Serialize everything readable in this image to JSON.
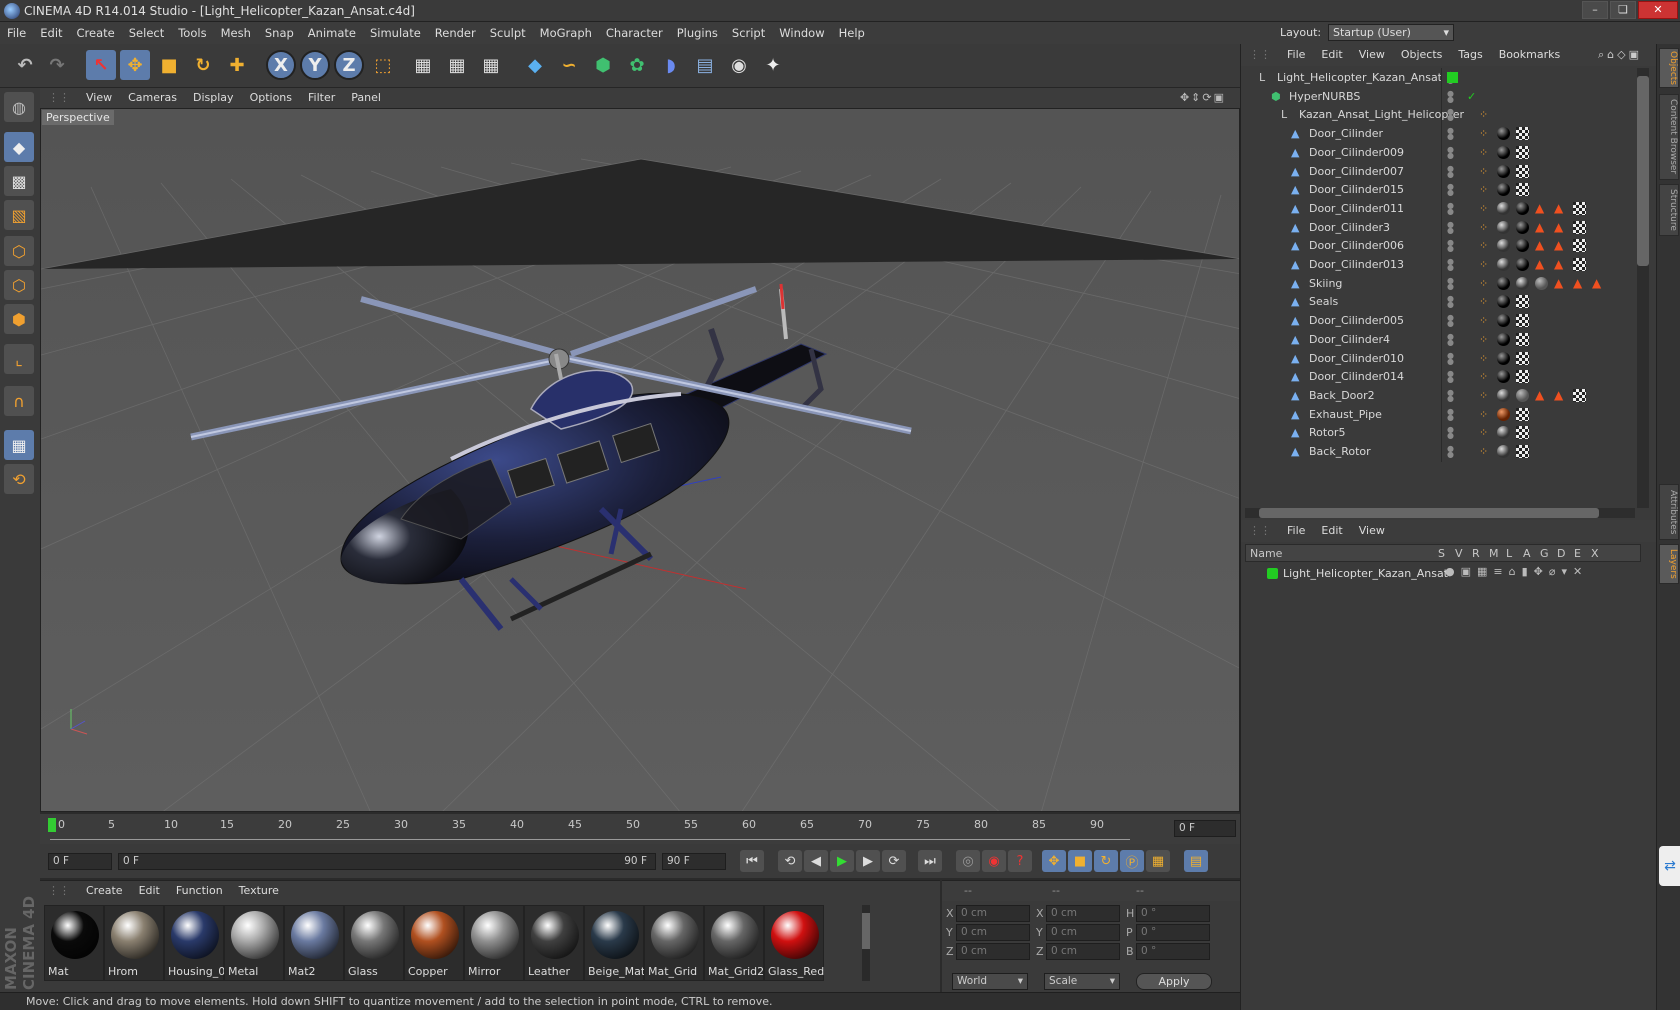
{
  "window": {
    "title": "CINEMA 4D R14.014 Studio - [Light_Helicopter_Kazan_Ansat.c4d]",
    "controls": [
      "–",
      "❏",
      "✕"
    ]
  },
  "menubar": [
    "File",
    "Edit",
    "Create",
    "Select",
    "Tools",
    "Mesh",
    "Snap",
    "Animate",
    "Simulate",
    "Render",
    "Sculpt",
    "MoGraph",
    "Character",
    "Plugins",
    "Script",
    "Window",
    "Help"
  ],
  "layout": {
    "label": "Layout:",
    "value": "Startup (User)"
  },
  "toolbar": {
    "x": "X",
    "y": "Y",
    "z": "Z"
  },
  "viewport": {
    "menu": [
      "View",
      "Cameras",
      "Display",
      "Options",
      "Filter",
      "Panel"
    ],
    "label": "Perspective"
  },
  "timeline": {
    "ticks": [
      "0",
      "5",
      "10",
      "15",
      "20",
      "25",
      "30",
      "35",
      "40",
      "45",
      "50",
      "55",
      "60",
      "65",
      "70",
      "75",
      "80",
      "85",
      "90"
    ],
    "frame_right": "0 F"
  },
  "transport": {
    "current": "0 F",
    "range_start": "0 F",
    "range_end": "90 F",
    "end": "90 F"
  },
  "materials": {
    "menu": [
      "Create",
      "Edit",
      "Function",
      "Texture"
    ],
    "items": [
      {
        "name": "Mat",
        "color": "#0a0a0a"
      },
      {
        "name": "Hrom",
        "color": "#8a8070"
      },
      {
        "name": "Housing_0",
        "color": "#2a3a6a"
      },
      {
        "name": "Metal",
        "color": "#a9a9a9"
      },
      {
        "name": "Mat2",
        "color": "#6a7aa0"
      },
      {
        "name": "Glass",
        "color": "#777777"
      },
      {
        "name": "Copper",
        "color": "#b05020"
      },
      {
        "name": "Mirror",
        "color": "#909090"
      },
      {
        "name": "Leather",
        "color": "#404040"
      },
      {
        "name": "Beige_Mat",
        "color": "#2a3a4a"
      },
      {
        "name": "Mat_Grid",
        "color": "#666666"
      },
      {
        "name": "Mat_Grid2",
        "color": "#666666"
      },
      {
        "name": "Glass_Red",
        "color": "#d01010"
      }
    ]
  },
  "coords": {
    "headers": [
      "--",
      "--",
      "--"
    ],
    "rows": [
      {
        "a": "X",
        "av": "0 cm",
        "b": "X",
        "bv": "0 cm",
        "c": "H",
        "cv": "0 °"
      },
      {
        "a": "Y",
        "av": "0 cm",
        "b": "Y",
        "bv": "0 cm",
        "c": "P",
        "cv": "0 °"
      },
      {
        "a": "Z",
        "av": "0 cm",
        "b": "Z",
        "bv": "0 cm",
        "c": "B",
        "cv": "0 °"
      }
    ],
    "world": "World",
    "scale": "Scale",
    "apply": "Apply"
  },
  "status": "Move: Click and drag to move elements. Hold down SHIFT to quantize movement / add to the selection in point mode, CTRL to remove.",
  "objects": {
    "menu": [
      "File",
      "Edit",
      "View",
      "Objects",
      "Tags",
      "Bookmarks"
    ],
    "rows": [
      {
        "name": "Light_Helicopter_Kazan_Ansat",
        "indent": 0,
        "tags": []
      },
      {
        "name": "HyperNURBS",
        "indent": 1,
        "tags": []
      },
      {
        "name": "Kazan_Ansat_Light_Helicopter",
        "indent": 2,
        "tags": []
      },
      {
        "name": "Door_Cilinder",
        "indent": 3,
        "tags": [
          "b",
          "c"
        ]
      },
      {
        "name": "Door_Cilinder009",
        "indent": 3,
        "tags": [
          "b",
          "c"
        ]
      },
      {
        "name": "Door_Cilinder007",
        "indent": 3,
        "tags": [
          "b",
          "c"
        ]
      },
      {
        "name": "Door_Cilinder015",
        "indent": 3,
        "tags": [
          "b",
          "c"
        ]
      },
      {
        "name": "Door_Cilinder011",
        "indent": 3,
        "tags": [
          "m",
          "b",
          "t",
          "t",
          "c"
        ]
      },
      {
        "name": "Door_Cilinder3",
        "indent": 3,
        "tags": [
          "m",
          "b",
          "t",
          "t",
          "c"
        ]
      },
      {
        "name": "Door_Cilinder006",
        "indent": 3,
        "tags": [
          "m",
          "b",
          "t",
          "t",
          "c"
        ]
      },
      {
        "name": "Door_Cilinder013",
        "indent": 3,
        "tags": [
          "m",
          "b",
          "t",
          "t",
          "c"
        ]
      },
      {
        "name": "Skiing",
        "indent": 3,
        "tags": [
          "b",
          "m",
          "g",
          "t",
          "t",
          "t"
        ]
      },
      {
        "name": "Seals",
        "indent": 3,
        "tags": [
          "b",
          "c"
        ]
      },
      {
        "name": "Door_Cilinder005",
        "indent": 3,
        "tags": [
          "b",
          "c"
        ]
      },
      {
        "name": "Door_Cilinder4",
        "indent": 3,
        "tags": [
          "b",
          "c"
        ]
      },
      {
        "name": "Door_Cilinder010",
        "indent": 3,
        "tags": [
          "b",
          "c"
        ]
      },
      {
        "name": "Door_Cilinder014",
        "indent": 3,
        "tags": [
          "b",
          "c"
        ]
      },
      {
        "name": "Back_Door2",
        "indent": 3,
        "tags": [
          "m",
          "g",
          "t",
          "t",
          "c"
        ]
      },
      {
        "name": "Exhaust_Pipe",
        "indent": 3,
        "tags": [
          "r",
          "c"
        ]
      },
      {
        "name": "Rotor5",
        "indent": 3,
        "tags": [
          "m",
          "c"
        ]
      },
      {
        "name": "Back_Rotor",
        "indent": 3,
        "tags": [
          "m",
          "c"
        ]
      }
    ]
  },
  "attributes": {
    "menu": [
      "File",
      "Edit",
      "View"
    ],
    "name_header": "Name",
    "cols": [
      "S",
      "V",
      "R",
      "M",
      "L",
      "A",
      "G",
      "D",
      "E",
      "X"
    ],
    "row": "Light_Helicopter_Kazan_Ansat"
  },
  "side_tabs": [
    "Objects",
    "Content Browser",
    "Structure",
    "Attributes",
    "Layers"
  ],
  "branding": "MAXON CINEMA 4D"
}
